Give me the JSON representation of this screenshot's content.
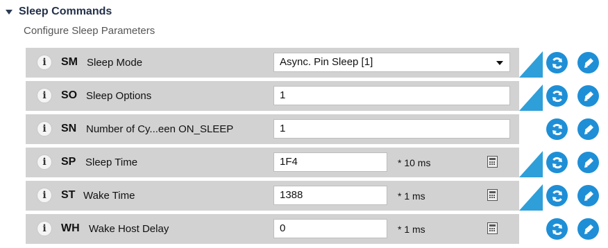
{
  "section": {
    "title": "Sleep Commands",
    "subtitle": "Configure Sleep Parameters"
  },
  "info_glyph": "i",
  "colors": {
    "accent": "#1e8fd6",
    "marker": "#2e9fd8",
    "row_bg": "#d2d2d2"
  },
  "rows": [
    {
      "code": "SM",
      "name": "Sleep Mode",
      "value": "Async. Pin Sleep [1]",
      "control": "select",
      "unit": "",
      "modified": true
    },
    {
      "code": "SO",
      "name": "Sleep Options",
      "value": "1",
      "control": "text",
      "unit": "",
      "modified": true
    },
    {
      "code": "SN",
      "name": "Number of Cy...een ON_SLEEP",
      "value": "1",
      "control": "text",
      "unit": "",
      "modified": false
    },
    {
      "code": "SP",
      "name": "Sleep Time",
      "value": "1F4",
      "control": "text-unit",
      "unit": "* 10 ms",
      "modified": true
    },
    {
      "code": "ST",
      "name": "Wake Time",
      "value": "1388",
      "control": "text-unit",
      "unit": "* 1 ms",
      "modified": true
    },
    {
      "code": "WH",
      "name": "Wake Host Delay",
      "value": "0",
      "control": "text-unit",
      "unit": "* 1 ms",
      "modified": false
    }
  ],
  "icons": {
    "collapse": "triangle-down-icon",
    "info": "info-icon",
    "read": "refresh-icon",
    "write": "pencil-icon",
    "calculator": "calculator-icon"
  }
}
